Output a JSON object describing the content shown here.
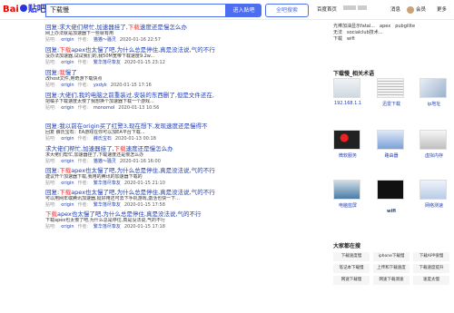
{
  "header": {
    "logo_text_1": "Bai",
    "logo_text_2": "贴吧",
    "search_value": "下载慢",
    "search_in_bar": "进入贴吧",
    "search_all": "全吧搜索",
    "nav_left": "百度首页",
    "nav_message": "消息",
    "nav_member": "会员",
    "nav_more": "更多"
  },
  "results": [
    {
      "title_pre": "回复:求大佬们帮忙,加速器挂了,",
      "title_kw": "下载",
      "title_post": "速度还是慢怎么办",
      "abstract": "网上办法就是加速器下一些就有用",
      "bar": "origin",
      "author": "猫猫～骚灵",
      "time": "2020-01-16 22:57"
    },
    {
      "title_pre": "回复:",
      "title_kw": "下载",
      "title_post": "apex也太慢了吧,为什么总是停住,真是没法说,气的不行",
      "abstract": "没办法加速器,试试我们的,我50M宽带下载速度9.2w...",
      "bar": "origin",
      "author": "繁华落尽挚友",
      "time": "2020-01-15 23:12"
    },
    {
      "title_pre": "回复:",
      "title_kw": "我",
      "title_post": "慢了",
      "abstract": "改host文件,用奇游下载快点",
      "bar": "origin",
      "author": "yxdyk",
      "time": "2020-01-15 17:16"
    },
    {
      "title_pre": "回复:大佬们,我的电脑之前重装过,安装的东西删了,但是文件还在,",
      "title_kw": "",
      "title_post": "",
      "abstract": "把橘子下载速度太慢了我想换个加速器下载一个游戏...",
      "bar": "origin",
      "author": "monomol",
      "time": "2020-01-13 10:56"
    },
    {
      "title_pre": "回复:我以前在origin买了红警3,现在想下,发现速度还是慢得不",
      "title_kw": "",
      "title_post": "",
      "abstract": "回复 薛氏宝石：EA游戏在你可以加EA平台下载...",
      "bar": "origin",
      "author": "薛氏宝石",
      "time": "2020-01-13 00:18"
    },
    {
      "title_pre": "求大佬们帮忙,加速器挂了,",
      "title_kw": "下载",
      "title_post": "速度还是慢怎么办",
      "abstract": "求大佬们帮忙,加速器挂了,下载速度还是慢怎么办",
      "bar": "origin",
      "author": "猫猫～骚灵",
      "time": "2020-01-16 16:00"
    },
    {
      "title_pre": "回复:",
      "title_kw": "下载",
      "title_post": "apex也太慢了吧,为什么总是停住,真是没法说,气的不行",
      "abstract": "建议开个加速器下载,我用的腾讯的加速器下载的",
      "bar": "origin",
      "author": "繁华落尽挚友",
      "time": "2020-01-15 21:10"
    },
    {
      "title_pre": "回复:",
      "title_kw": "下载",
      "title_post": "apex也太慢了吧,为什么总是停住,真是没法说,气的不行",
      "abstract": "可以用网年或腾讯加速器,挺好用还可去下手机游戏,激活也快一下...",
      "bar": "origin",
      "author": "繁华落尽挚友",
      "time": "2020-01-15 17:58"
    },
    {
      "title_pre": "",
      "title_kw": "下载",
      "title_post": "apex也太慢了吧,为什么总是停住,真是没法说,气的不行",
      "abstract": "下载apex也太慢了吧,为什么总是停住,真是没法说,气的不行",
      "bar": "origin",
      "author": "繁华落尽挚友",
      "time": "2020-01-15 17:18"
    }
  ],
  "labels": {
    "bar_prefix": "贴吧:",
    "author_prefix": "作者:"
  },
  "sidebar": {
    "top_links": [
      "光棒加油显示fatal...",
      "apex",
      "pubgilite",
      "无法",
      "socialclub技术...",
      "下载",
      "wifi"
    ],
    "related_title": "下载慢_相关术语",
    "thumbs": [
      {
        "cap": "192.168.1.1"
      },
      {
        "cap": "迅雷下载"
      },
      {
        "cap": "ip地址"
      },
      {
        "cap": "微软服务"
      },
      {
        "cap": "路由器"
      },
      {
        "cap": "虚拟内存"
      },
      {
        "cap": "电脑蓝屏"
      },
      {
        "cap": "wifi"
      },
      {
        "cap": "网络测速"
      }
    ],
    "search_title": "大家都在搜",
    "searches": [
      "下载速度慢",
      "iphone下载慢",
      "下载APP很慢",
      "笔记本下载慢",
      "上传和下载速度",
      "下载速度提升",
      "网速下载慢",
      "网速下载测速",
      "速度太慢"
    ]
  }
}
